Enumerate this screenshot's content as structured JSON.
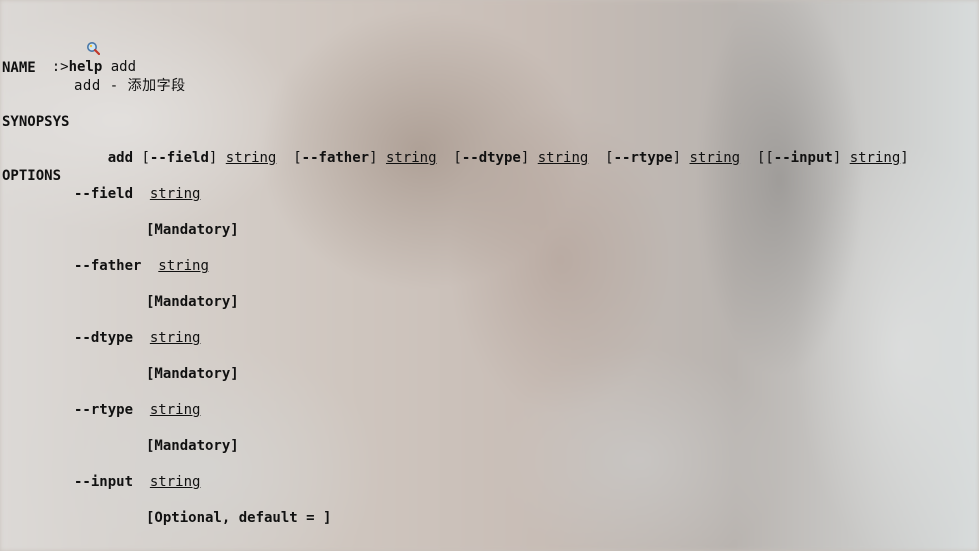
{
  "prompt": {
    "icon": "magnifier-icon",
    "prefix": ":>",
    "command": "help add"
  },
  "name_section": {
    "heading": "NAME",
    "description": "add - 添加字段"
  },
  "synopsis_section": {
    "heading": "SYNOPSYS",
    "command": "add",
    "args": [
      {
        "open": "[",
        "flag": "--field",
        "close": "]",
        "type": "string"
      },
      {
        "open": "[",
        "flag": "--father",
        "close": "]",
        "type": "string"
      },
      {
        "open": "[",
        "flag": "--dtype",
        "close": "]",
        "type": "string"
      },
      {
        "open": "[",
        "flag": "--rtype",
        "close": "]",
        "type": "string"
      },
      {
        "open": "[[",
        "flag": "--input",
        "close": "]",
        "type": "string",
        "trail": "]"
      }
    ]
  },
  "options_section": {
    "heading": "OPTIONS",
    "options": [
      {
        "flag": "--field",
        "type": "string",
        "note": "[Mandatory]"
      },
      {
        "flag": "--father",
        "type": "string",
        "note": "[Mandatory]"
      },
      {
        "flag": "--dtype",
        "type": "string",
        "note": "[Mandatory]"
      },
      {
        "flag": "--rtype",
        "type": "string",
        "note": "[Mandatory]"
      },
      {
        "flag": "--input",
        "type": "string",
        "note": "[Optional, default = ]"
      }
    ]
  }
}
